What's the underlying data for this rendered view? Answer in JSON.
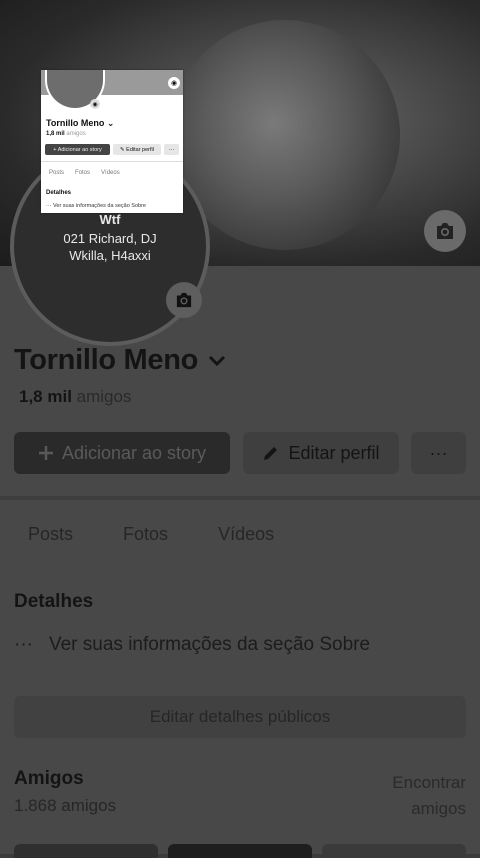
{
  "cover": {
    "camera_icon": "camera-icon"
  },
  "avatar": {
    "line1": "Wtf",
    "line2": "021 Richard, DJ",
    "line3": "Wkilla, H4axxi"
  },
  "preview": {
    "name": "Tornillo Meno",
    "count": "1,8 mil",
    "count_label": "amigos",
    "add_story": "+ Adicionar ao story",
    "edit": "✎ Editar perfil",
    "more": "···",
    "tabs": [
      "Posts",
      "Fotos",
      "Vídeos"
    ],
    "details_title": "Detalhes",
    "details_info": "··· Ver suas informações da seção Sobre"
  },
  "profile": {
    "name": "Tornillo Meno",
    "friends_count": "1,8 mil",
    "friends_label": "amigos"
  },
  "actions": {
    "add_story": "Adicionar ao story",
    "edit_profile": "Editar perfil",
    "more": "···"
  },
  "tabs": [
    "Posts",
    "Fotos",
    "Vídeos"
  ],
  "details": {
    "title": "Detalhes",
    "info": "Ver suas informações da seção Sobre",
    "edit_public": "Editar detalhes públicos"
  },
  "friends": {
    "title": "Amigos",
    "count": "1.868 amigos",
    "find": "Encontrar amigos"
  },
  "colors": {
    "overlay": "#484848",
    "button_dark": "#2a2a2a"
  }
}
